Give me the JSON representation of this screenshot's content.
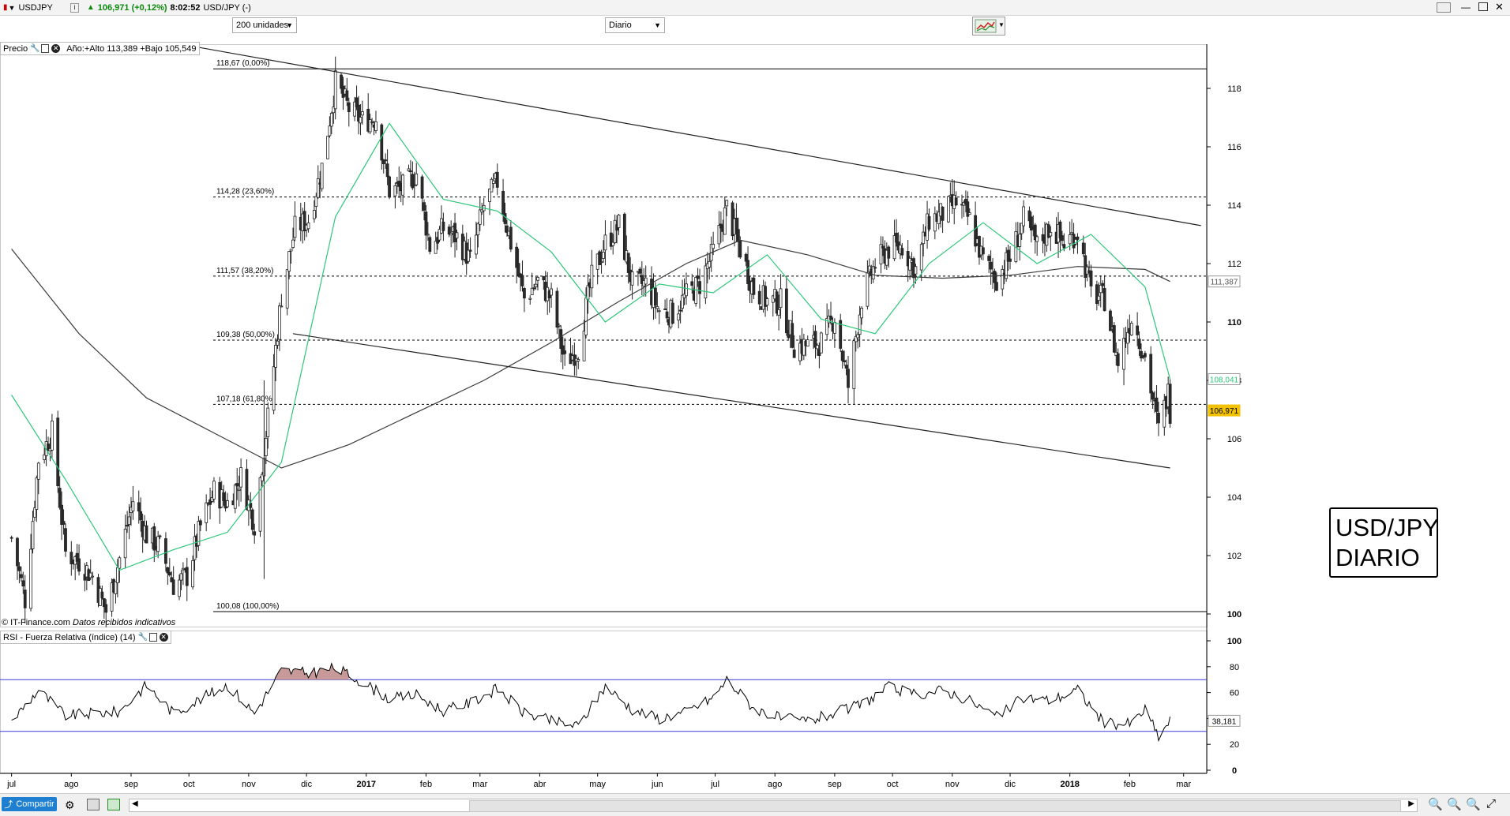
{
  "titlebar": {
    "symbol": "USDJPY",
    "last": "106,971 (+0,12%)",
    "time": "8:02:52",
    "instrument": "USD/JPY (-)"
  },
  "toolbar": {
    "units": "200 unidades",
    "period": "Diario"
  },
  "price_panel": {
    "label": "Precio",
    "year_info": "Año:+Alto 113,389 +Bajo 105,549"
  },
  "rsi_panel": {
    "label": "RSI - Fuerza Relativa (índice) (14)"
  },
  "credit": {
    "source": "© IT-Finance.com",
    "note": "Datos recibidos indicativos"
  },
  "watermark": {
    "line1": "USD/JPY",
    "line2": "DIARIO"
  },
  "statusbar": {
    "share": "Compartir"
  },
  "colors": {
    "sma_fast": "#2ec67a",
    "sma_slow": "#3a3a3a",
    "bull": "#ffffff",
    "bear": "#2b2b2b",
    "rsi_band": "#3b3bd1",
    "rsi_fill": "#c79999",
    "last_badge": "#f2c200"
  },
  "chart_data": [
    {
      "type": "candlestick",
      "title": "USD/JPY",
      "ylim": [
        99.0,
        119.5
      ],
      "y_ticks": [
        100,
        102,
        104,
        106,
        108,
        110,
        112,
        114,
        116,
        118
      ],
      "x_tick_labels": [
        "jul",
        "ago",
        "sep",
        "oct",
        "nov",
        "dic",
        "2017",
        "feb",
        "mar",
        "abr",
        "may",
        "jun",
        "jul",
        "ago",
        "sep",
        "oct",
        "nov",
        "dic",
        "2018",
        "feb",
        "mar"
      ],
      "fib_levels": [
        {
          "label": "118,67 (0,00%)",
          "value": 118.67
        },
        {
          "label": "114,28 (23,60%)",
          "value": 114.28
        },
        {
          "label": "111,57 (38,20%)",
          "value": 111.57
        },
        {
          "label": "109,38 (50,00%)",
          "value": 109.38
        },
        {
          "label": "107,18 (61,80%)",
          "value": 107.18
        },
        {
          "label": "100,08 (100,00%)",
          "value": 100.08
        }
      ],
      "badges": [
        {
          "label": "111,387",
          "value": 111.387
        },
        {
          "label": "108,041",
          "value": 108.041
        },
        {
          "label": "106,971",
          "value": 106.971
        }
      ],
      "close_path": [
        [
          "2016-07-01",
          102.6
        ],
        [
          "2016-07-08",
          100.5
        ],
        [
          "2016-07-15",
          105.3
        ],
        [
          "2016-07-22",
          106.2
        ],
        [
          "2016-07-29",
          102.1
        ],
        [
          "2016-08-05",
          101.8
        ],
        [
          "2016-08-12",
          101.3
        ],
        [
          "2016-08-19",
          100.1
        ],
        [
          "2016-08-26",
          101.9
        ],
        [
          "2016-09-02",
          103.9
        ],
        [
          "2016-09-09",
          102.7
        ],
        [
          "2016-09-16",
          102.3
        ],
        [
          "2016-09-23",
          101.0
        ],
        [
          "2016-09-30",
          101.3
        ],
        [
          "2016-10-07",
          103.0
        ],
        [
          "2016-10-14",
          104.2
        ],
        [
          "2016-10-21",
          103.8
        ],
        [
          "2016-10-28",
          104.7
        ],
        [
          "2016-11-04",
          103.1
        ],
        [
          "2016-11-11",
          106.7
        ],
        [
          "2016-11-18",
          110.9
        ],
        [
          "2016-11-25",
          113.2
        ],
        [
          "2016-12-02",
          113.5
        ],
        [
          "2016-12-09",
          115.3
        ],
        [
          "2016-12-16",
          118.2
        ],
        [
          "2016-12-23",
          117.3
        ],
        [
          "2016-12-30",
          116.9
        ],
        [
          "2017-01-06",
          117.0
        ],
        [
          "2017-01-13",
          114.5
        ],
        [
          "2017-01-20",
          114.6
        ],
        [
          "2017-01-27",
          115.1
        ],
        [
          "2017-02-03",
          112.6
        ],
        [
          "2017-02-10",
          113.2
        ],
        [
          "2017-02-17",
          112.9
        ],
        [
          "2017-02-24",
          112.1
        ],
        [
          "2017-03-03",
          114.0
        ],
        [
          "2017-03-10",
          114.8
        ],
        [
          "2017-03-17",
          112.7
        ],
        [
          "2017-03-24",
          110.8
        ],
        [
          "2017-03-31",
          111.4
        ],
        [
          "2017-04-07",
          110.8
        ],
        [
          "2017-04-14",
          108.6
        ],
        [
          "2017-04-21",
          109.1
        ],
        [
          "2017-04-28",
          111.5
        ],
        [
          "2017-05-05",
          112.7
        ],
        [
          "2017-05-12",
          113.3
        ],
        [
          "2017-05-19",
          111.3
        ],
        [
          "2017-05-26",
          111.3
        ],
        [
          "2017-06-02",
          110.4
        ],
        [
          "2017-06-09",
          110.3
        ],
        [
          "2017-06-16",
          110.9
        ],
        [
          "2017-06-23",
          111.3
        ],
        [
          "2017-06-30",
          112.4
        ],
        [
          "2017-07-07",
          113.9
        ],
        [
          "2017-07-14",
          112.5
        ],
        [
          "2017-07-21",
          111.1
        ],
        [
          "2017-07-28",
          110.7
        ],
        [
          "2017-08-04",
          110.7
        ],
        [
          "2017-08-11",
          109.2
        ],
        [
          "2017-08-18",
          109.2
        ],
        [
          "2017-08-25",
          109.3
        ],
        [
          "2017-09-01",
          110.2
        ],
        [
          "2017-09-08",
          107.8
        ],
        [
          "2017-09-15",
          110.8
        ],
        [
          "2017-09-22",
          112.0
        ],
        [
          "2017-09-29",
          112.5
        ],
        [
          "2017-10-06",
          112.6
        ],
        [
          "2017-10-13",
          111.8
        ],
        [
          "2017-10-20",
          113.5
        ],
        [
          "2017-10-27",
          113.7
        ],
        [
          "2017-11-03",
          114.1
        ],
        [
          "2017-11-10",
          113.5
        ],
        [
          "2017-11-17",
          112.1
        ],
        [
          "2017-11-24",
          111.5
        ],
        [
          "2017-12-01",
          112.2
        ],
        [
          "2017-12-08",
          113.5
        ],
        [
          "2017-12-15",
          112.6
        ],
        [
          "2017-12-22",
          113.3
        ],
        [
          "2017-12-29",
          112.7
        ],
        [
          "2018-01-05",
          113.1
        ],
        [
          "2018-01-12",
          111.0
        ],
        [
          "2018-01-19",
          110.8
        ],
        [
          "2018-01-26",
          108.6
        ],
        [
          "2018-02-02",
          110.2
        ],
        [
          "2018-02-09",
          108.8
        ],
        [
          "2018-02-16",
          106.3
        ],
        [
          "2018-02-21",
          107.6
        ],
        [
          "2018-02-22",
          106.971
        ]
      ],
      "sma_fast_path": [
        [
          "2016-07-01",
          107.5
        ],
        [
          "2016-07-29",
          104.6
        ],
        [
          "2016-08-26",
          101.5
        ],
        [
          "2016-09-23",
          102.2
        ],
        [
          "2016-10-21",
          102.8
        ],
        [
          "2016-11-18",
          105.2
        ],
        [
          "2016-12-16",
          113.6
        ],
        [
          "2017-01-13",
          116.8
        ],
        [
          "2017-02-10",
          114.2
        ],
        [
          "2017-03-10",
          113.8
        ],
        [
          "2017-04-07",
          112.4
        ],
        [
          "2017-05-05",
          110.0
        ],
        [
          "2017-06-02",
          111.3
        ],
        [
          "2017-06-30",
          111.0
        ],
        [
          "2017-07-28",
          112.3
        ],
        [
          "2017-08-25",
          110.1
        ],
        [
          "2017-09-22",
          109.6
        ],
        [
          "2017-10-20",
          112.0
        ],
        [
          "2017-11-17",
          113.4
        ],
        [
          "2017-12-15",
          112.0
        ],
        [
          "2018-01-12",
          113.0
        ],
        [
          "2018-02-09",
          111.2
        ],
        [
          "2018-02-22",
          108.041
        ]
      ],
      "sma_slow_path": [
        [
          "2016-07-01",
          112.5
        ],
        [
          "2016-08-05",
          109.6
        ],
        [
          "2016-09-09",
          107.4
        ],
        [
          "2016-10-14",
          106.2
        ],
        [
          "2016-11-18",
          105.0
        ],
        [
          "2016-12-23",
          105.8
        ],
        [
          "2017-01-27",
          106.9
        ],
        [
          "2017-03-03",
          108.0
        ],
        [
          "2017-04-07",
          109.3
        ],
        [
          "2017-05-12",
          110.7
        ],
        [
          "2017-06-16",
          112.0
        ],
        [
          "2017-07-14",
          112.8
        ],
        [
          "2017-08-18",
          112.3
        ],
        [
          "2017-09-22",
          111.6
        ],
        [
          "2017-10-27",
          111.5
        ],
        [
          "2017-12-01",
          111.6
        ],
        [
          "2018-01-05",
          111.9
        ],
        [
          "2018-02-09",
          111.8
        ],
        [
          "2018-02-22",
          111.387
        ]
      ],
      "trendlines": [
        {
          "from": [
            "2016-09-28",
            119.5
          ],
          "to": [
            "2018-03-10",
            113.3
          ]
        },
        {
          "from": [
            "2016-11-24",
            109.6
          ],
          "to": [
            "2018-02-22",
            105.0
          ]
        }
      ]
    },
    {
      "type": "line",
      "title": "RSI - Fuerza Relativa (índice) (14)",
      "ylim": [
        0,
        100
      ],
      "y_ticks": [
        0,
        20,
        40,
        60,
        80,
        100
      ],
      "bands": [
        30,
        70
      ],
      "last": {
        "label": "38,181",
        "value": 38.181
      },
      "path": [
        [
          "2016-07-01",
          38
        ],
        [
          "2016-07-15",
          62
        ],
        [
          "2016-07-29",
          42
        ],
        [
          "2016-08-12",
          44
        ],
        [
          "2016-08-26",
          45
        ],
        [
          "2016-09-09",
          66
        ],
        [
          "2016-09-23",
          44
        ],
        [
          "2016-10-07",
          55
        ],
        [
          "2016-10-21",
          66
        ],
        [
          "2016-11-04",
          44
        ],
        [
          "2016-11-18",
          77
        ],
        [
          "2016-12-02",
          75
        ],
        [
          "2016-12-16",
          79
        ],
        [
          "2016-12-30",
          68
        ],
        [
          "2017-01-13",
          55
        ],
        [
          "2017-01-27",
          58
        ],
        [
          "2017-02-10",
          46
        ],
        [
          "2017-02-24",
          52
        ],
        [
          "2017-03-10",
          63
        ],
        [
          "2017-03-24",
          44
        ],
        [
          "2017-04-07",
          38
        ],
        [
          "2017-04-21",
          34
        ],
        [
          "2017-05-05",
          65
        ],
        [
          "2017-05-19",
          47
        ],
        [
          "2017-06-02",
          40
        ],
        [
          "2017-06-16",
          45
        ],
        [
          "2017-06-30",
          56
        ],
        [
          "2017-07-07",
          70
        ],
        [
          "2017-07-21",
          48
        ],
        [
          "2017-08-04",
          40
        ],
        [
          "2017-08-18",
          38
        ],
        [
          "2017-09-01",
          44
        ],
        [
          "2017-09-15",
          51
        ],
        [
          "2017-09-29",
          64
        ],
        [
          "2017-10-13",
          58
        ],
        [
          "2017-10-27",
          62
        ],
        [
          "2017-11-10",
          54
        ],
        [
          "2017-11-24",
          41
        ],
        [
          "2017-12-08",
          56
        ],
        [
          "2017-12-22",
          54
        ],
        [
          "2018-01-05",
          62
        ],
        [
          "2018-01-19",
          36
        ],
        [
          "2018-02-02",
          36
        ],
        [
          "2018-02-09",
          47
        ],
        [
          "2018-02-16",
          26
        ],
        [
          "2018-02-22",
          38.181
        ]
      ]
    }
  ]
}
